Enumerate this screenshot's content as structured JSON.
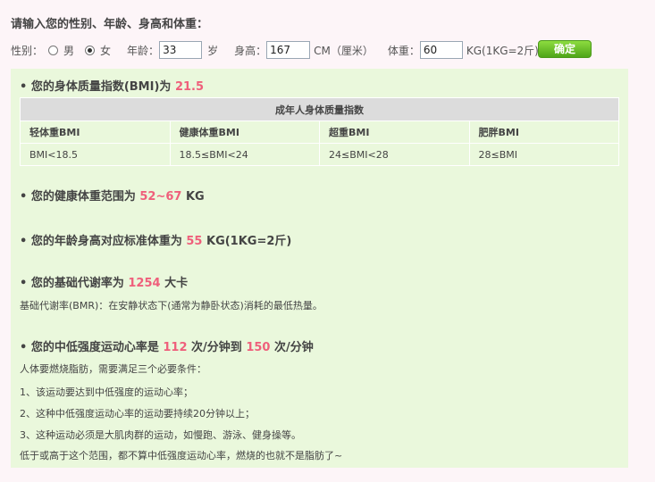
{
  "title": "请输入您的性别、年龄、身高和体重：",
  "form": {
    "gender_label": "性别：",
    "male_label": "男",
    "female_label": "女",
    "selected_gender": "女",
    "age_label": "年龄：",
    "age_value": "33",
    "age_unit": "岁",
    "height_label": "身高：",
    "height_value": "167",
    "height_unit": "CM（厘米）",
    "weight_label": "体重：",
    "weight_value": "60",
    "weight_unit": "KG(1KG=2斤)",
    "submit_label": "确定"
  },
  "results": {
    "bmi": {
      "prefix": "• 您的身体质量指数(BMI)为 ",
      "value": "21.5"
    },
    "table": {
      "caption": "成年人身体质量指数",
      "headers": [
        "轻体重BMI",
        "健康体重BMI",
        "超重BMI",
        "肥胖BMI"
      ],
      "values": [
        "BMI<18.5",
        "18.5≤BMI<24",
        "24≤BMI<28",
        "28≤BMI"
      ]
    },
    "healthy_range": {
      "prefix": "• 您的健康体重范围为 ",
      "value": "52~67",
      "suffix": " KG"
    },
    "standard_weight": {
      "prefix": "• 您的年龄身高对应标准体重为 ",
      "value": "55",
      "suffix": " KG(1KG=2斤)"
    },
    "bmr": {
      "prefix": "• 您的基础代谢率为 ",
      "value": "1254",
      "suffix": " 大卡",
      "description": "基础代谢率(BMR)：在安静状态下(通常为静卧状态)消耗的最低热量。"
    },
    "heart_rate": {
      "prefix": "• 您的中低强度运动心率是 ",
      "low": "112",
      "middle": " 次/分钟到 ",
      "high": "150",
      "suffix": " 次/分钟",
      "notes": [
        "人体要燃烧脂肪，需要满足三个必要条件：",
        "1、该运动要达到中低强度的运动心率；",
        "2、这种中低强度运动心率的运动要持续20分钟以上；",
        "3、这种运动必须是大肌肉群的运动，如慢跑、游泳、健身操等。",
        "低于或高于这个范围，都不算中低强度运动心率，燃烧的也就不是脂肪了~"
      ]
    }
  }
}
